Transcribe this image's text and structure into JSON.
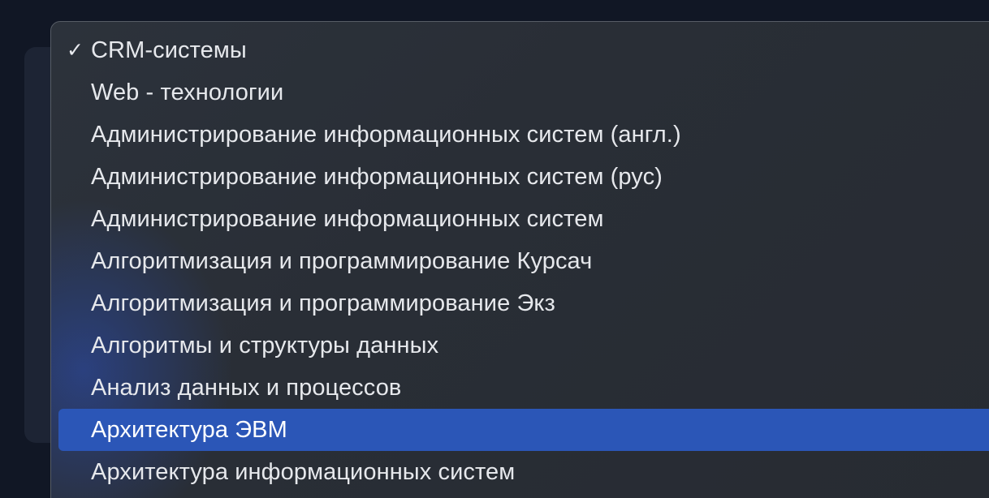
{
  "menu": {
    "checkmark": "✓",
    "items": [
      {
        "label": "CRM-системы",
        "checked": true,
        "highlighted": false
      },
      {
        "label": "Web - технологии",
        "checked": false,
        "highlighted": false
      },
      {
        "label": "Администрирование информационных систем (англ.)",
        "checked": false,
        "highlighted": false
      },
      {
        "label": "Администрирование информационных систем (рус)",
        "checked": false,
        "highlighted": false
      },
      {
        "label": "Администрирование информационных систем",
        "checked": false,
        "highlighted": false
      },
      {
        "label": "Алгоритмизация и программирование Курсач",
        "checked": false,
        "highlighted": false
      },
      {
        "label": "Алгоритмизация и программирование Экз",
        "checked": false,
        "highlighted": false
      },
      {
        "label": "Алгоритмы и структуры данных",
        "checked": false,
        "highlighted": false
      },
      {
        "label": "Анализ данных и процессов",
        "checked": false,
        "highlighted": false
      },
      {
        "label": "Архитектура ЭВМ",
        "checked": false,
        "highlighted": true
      },
      {
        "label": "Архитектура информационных систем",
        "checked": false,
        "highlighted": false
      }
    ]
  },
  "colors": {
    "highlight": "#2b56b7",
    "menu_background": "#2a2f37",
    "page_background": "#111725"
  }
}
